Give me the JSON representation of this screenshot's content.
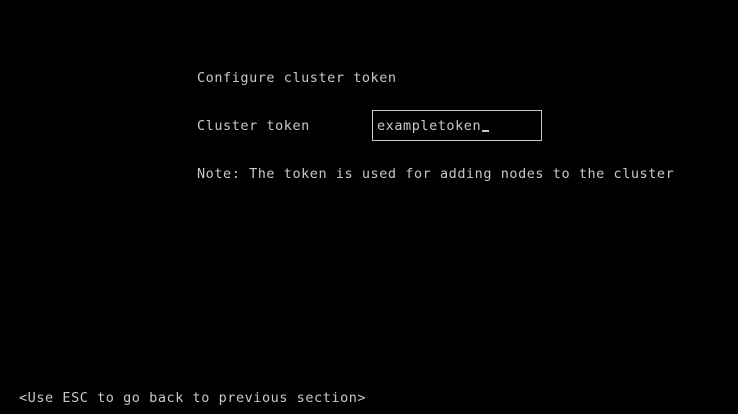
{
  "screen": {
    "title": "Configure cluster token",
    "field_label": "Cluster token",
    "field_value": "exampletoken",
    "note": "Note: The token is used for adding nodes to the cluster",
    "footer_hint": "<Use ESC to go back to previous section>"
  },
  "colors": {
    "background": "#000000",
    "foreground": "#c8c8c8"
  }
}
